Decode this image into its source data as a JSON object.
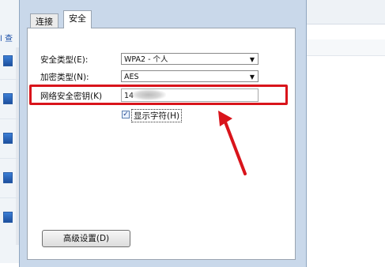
{
  "tabs": [
    {
      "label": "连接",
      "active": false
    },
    {
      "label": "安全",
      "active": true
    }
  ],
  "security_type": {
    "label": "安全类型(E):",
    "value": "WPA2 - 个人"
  },
  "encryption_type": {
    "label": "加密类型(N):",
    "value": "AES"
  },
  "network_key": {
    "label": "网络安全密钥(K)",
    "value": "14"
  },
  "show_characters": {
    "label": "显示字符(H)",
    "checked": true
  },
  "advanced_button": {
    "label": "高级设置(D)"
  },
  "background_window": {
    "link_text": "l 查"
  },
  "colors": {
    "highlight": "#d9141b",
    "arrow": "#d9141b"
  }
}
